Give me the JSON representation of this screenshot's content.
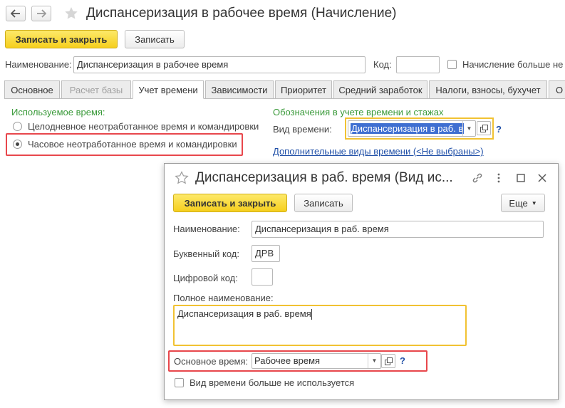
{
  "window": {
    "title": "Диспансеризация в рабочее время (Начисление)",
    "back_icon": "arrow-left-icon",
    "forward_icon": "arrow-right-icon",
    "favorite_icon": "star-icon"
  },
  "toolbar": {
    "save_close_label": "Записать и закрыть",
    "save_label": "Записать"
  },
  "header": {
    "name_label": "Наименование:",
    "name_value": "Диспансеризация в рабочее время",
    "code_label": "Код:",
    "code_value": "",
    "not_used_label": "Начисление больше не"
  },
  "tabs": [
    {
      "label": "Основное"
    },
    {
      "label": "Расчет базы"
    },
    {
      "label": "Учет времени"
    },
    {
      "label": "Зависимости"
    },
    {
      "label": "Приоритет"
    },
    {
      "label": "Средний заработок"
    },
    {
      "label": "Налоги, взносы, бухучет"
    },
    {
      "label": "О"
    }
  ],
  "time_section": {
    "title": "Используемое время:",
    "option1": "Целодневное неотработанное время и командировки",
    "option2": "Часовое неотработанное время и командировки",
    "selected": 2
  },
  "designations": {
    "title": "Обозначения в учете времени и стажах",
    "kind_label": "Вид времени:",
    "kind_value": "Диспансеризация в раб. в",
    "help": "?",
    "additional_link": "Дополнительные виды времени (<Не выбраны>)"
  },
  "dialog": {
    "title": "Диспансеризация в раб. время (Вид ис...",
    "save_close_label": "Записать и закрыть",
    "save_label": "Записать",
    "more_label": "Еще",
    "name_label": "Наименование:",
    "name_value": "Диспансеризация в раб. время",
    "letter_code_label": "Буквенный код:",
    "letter_code_value": "ДРВ",
    "digit_code_label": "Цифровой код:",
    "digit_code_value": "",
    "full_name_label": "Полное наименование:",
    "full_name_value": "Диспансеризация в раб. время",
    "main_time_label": "Основное время:",
    "main_time_value": "Рабочее время",
    "help": "?",
    "not_used_label": "Вид времени больше не используется"
  },
  "colors": {
    "accent_yellow": "#f6cf1d",
    "highlight_red": "#e8474c",
    "highlight_yellow": "#f1c232",
    "green_title": "#3a9a3a",
    "link_blue": "#1f4fa7"
  }
}
